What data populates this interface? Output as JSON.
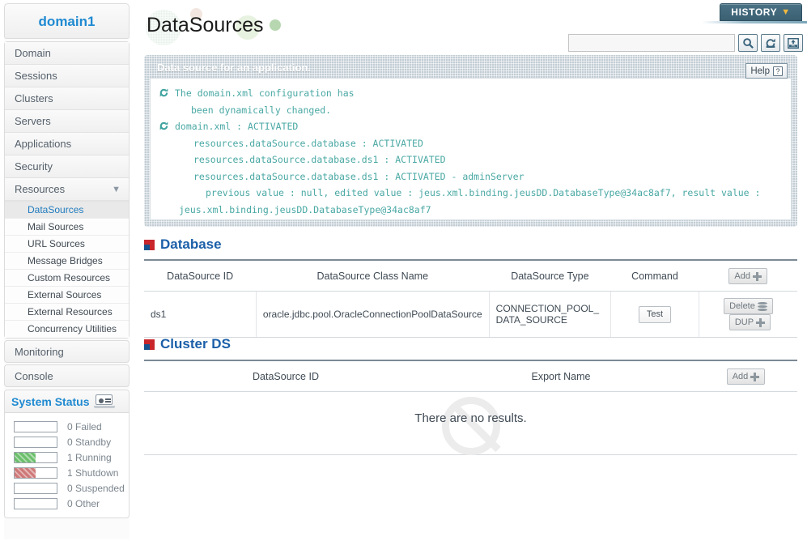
{
  "sidebar": {
    "domain_title": "domain1",
    "nav_items": [
      {
        "label": "Domain",
        "expandable": false
      },
      {
        "label": "Sessions",
        "expandable": false
      },
      {
        "label": "Clusters",
        "expandable": false
      },
      {
        "label": "Servers",
        "expandable": false
      },
      {
        "label": "Applications",
        "expandable": false
      },
      {
        "label": "Security",
        "expandable": false
      },
      {
        "label": "Resources",
        "expandable": true,
        "chevron": "chevron-down-icon"
      }
    ],
    "sub_items": [
      {
        "label": "DataSources",
        "active": true
      },
      {
        "label": "Mail Sources",
        "active": false
      },
      {
        "label": "URL Sources",
        "active": false
      },
      {
        "label": "Message Bridges",
        "active": false
      },
      {
        "label": "Custom Resources",
        "active": false
      },
      {
        "label": "External Sources",
        "active": false
      },
      {
        "label": "External Resources",
        "active": false
      },
      {
        "label": "Concurrency Utilities",
        "active": false
      }
    ],
    "bottom_items": [
      {
        "label": "Monitoring"
      },
      {
        "label": "Console"
      }
    ],
    "system_status": {
      "title": "System Status",
      "icon": "laptop-icon",
      "rows": [
        {
          "count": "0",
          "label": "Failed",
          "fill": 0,
          "color": "none"
        },
        {
          "count": "0",
          "label": "Standby",
          "fill": 0,
          "color": "none"
        },
        {
          "count": "1",
          "label": "Running",
          "fill": 50,
          "color": "green"
        },
        {
          "count": "1",
          "label": "Shutdown",
          "fill": 50,
          "color": "red"
        },
        {
          "count": "0",
          "label": "Suspended",
          "fill": 0,
          "color": "none"
        },
        {
          "count": "0",
          "label": "Other",
          "fill": 0,
          "color": "none"
        }
      ]
    }
  },
  "header": {
    "page_title": "DataSources",
    "history_label": "HISTORY",
    "history_chevron": "chevron-down-icon",
    "search_value": "",
    "search_placeholder": "",
    "toolbar_icons": [
      {
        "name": "search-icon"
      },
      {
        "name": "refresh-icon"
      },
      {
        "name": "xml-export-icon"
      }
    ]
  },
  "message_panel": {
    "heading": "Data source for an application.",
    "help_label": "Help",
    "help_icon": "question-mark-icon",
    "lines": [
      {
        "icon": "refresh-icon",
        "indent": 0,
        "text": "The domain.xml configuration has"
      },
      {
        "icon": null,
        "indent": 1,
        "text": "been dynamically changed."
      },
      {
        "icon": "refresh-icon",
        "indent": 0,
        "text": "domain.xml : ACTIVATED"
      },
      {
        "icon": null,
        "indent": 2,
        "text": "resources.dataSource.database : ACTIVATED"
      },
      {
        "icon": null,
        "indent": 2,
        "text": "resources.dataSource.database.ds1 : ACTIVATED"
      },
      {
        "icon": null,
        "indent": 2,
        "text": "resources.dataSource.database.ds1 : ACTIVATED - adminServer"
      },
      {
        "icon": null,
        "indent": 3,
        "text": "previous value : null, edited value : jeus.xml.binding.jeusDD.DatabaseType@34ac8af7, result value :"
      },
      {
        "icon": null,
        "indent": 2,
        "text": "jeus.xml.binding.jeusDD.DatabaseType@34ac8af7"
      }
    ]
  },
  "database_section": {
    "title": "Database",
    "icon": "section-square-icon",
    "add_label": "Add",
    "columns": [
      "DataSource ID",
      "DataSource Class Name",
      "DataSource Type",
      "Command"
    ],
    "rows": [
      {
        "datasource_id": "ds1",
        "class_name": "oracle.jdbc.pool.OracleConnectionPoolDataSource",
        "type": "CONNECTION_POOL_ DATA_SOURCE",
        "command_label": "Test",
        "delete_label": "Delete",
        "dup_label": "DUP"
      }
    ]
  },
  "cluster_section": {
    "title": "Cluster DS",
    "icon": "section-square-icon",
    "add_label": "Add",
    "columns": [
      "DataSource ID",
      "Export Name"
    ],
    "empty_text": "There are no results."
  },
  "colors": {
    "accent_blue": "#1b5fa8",
    "link_blue": "#1f8ad1",
    "log_teal": "#49a8a4",
    "history_bg": "#3a6072",
    "history_chevron": "#f0b840",
    "status_green": "#6cbf6c",
    "status_red": "#cf7878",
    "panel_texture": "#c2cdd4"
  }
}
